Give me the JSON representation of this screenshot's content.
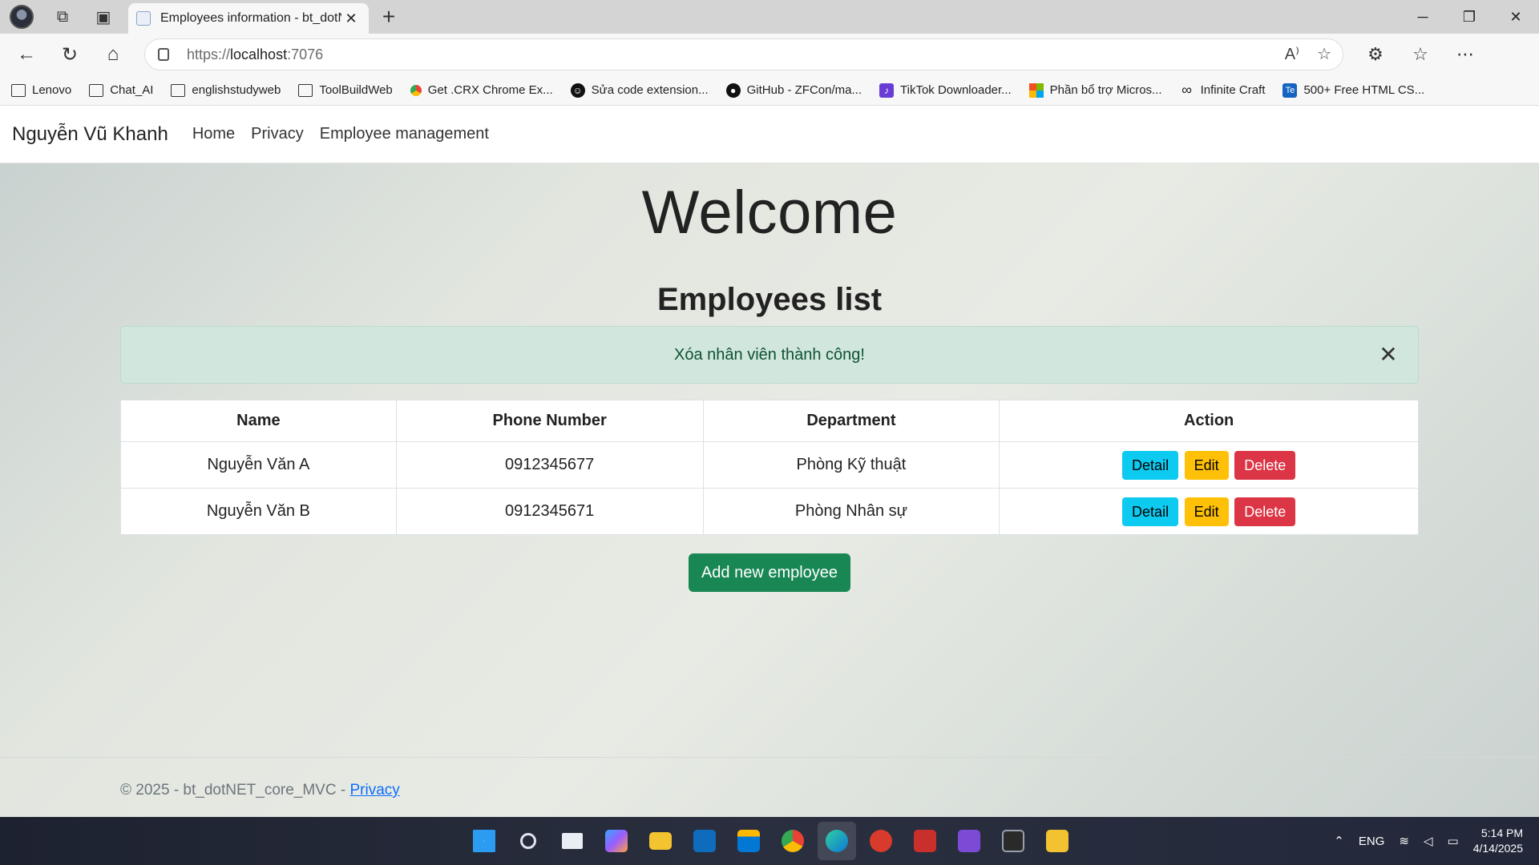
{
  "browser": {
    "tab_title": "Employees information - bt_dotNET_core_MVC",
    "url_scheme": "https://",
    "url_host": "localhost",
    "url_port": ":7076",
    "bookmarks": [
      {
        "label": "Lenovo",
        "icon": "folder-icon"
      },
      {
        "label": "Chat_AI",
        "icon": "folder-icon"
      },
      {
        "label": "englishstudyweb",
        "icon": "folder-icon"
      },
      {
        "label": "ToolBuildWeb",
        "icon": "folder-icon"
      },
      {
        "label": "Get .CRX Chrome Ex...",
        "icon": "chrome-icon"
      },
      {
        "label": "Sửa code extension...",
        "icon": "bot-icon"
      },
      {
        "label": "GitHub - ZFCon/ma...",
        "icon": "github-icon"
      },
      {
        "label": "TikTok Downloader...",
        "icon": "tiktok-icon"
      },
      {
        "label": "Phần bổ trợ Micros...",
        "icon": "microsoft-icon"
      },
      {
        "label": "Infinite Craft",
        "icon": "infinity-icon"
      },
      {
        "label": "500+ Free HTML CS...",
        "icon": "te-icon"
      }
    ]
  },
  "navbar": {
    "brand": "Nguyễn Vũ Khanh",
    "links": [
      "Home",
      "Privacy",
      "Employee management"
    ]
  },
  "main": {
    "welcome": "Welcome",
    "list_title": "Employees list",
    "alert": "Xóa nhân viên thành công!",
    "table": {
      "headers": [
        "Name",
        "Phone Number",
        "Department",
        "Action"
      ],
      "rows": [
        {
          "name": "Nguyễn Văn A",
          "phone": "0912345677",
          "department": "Phòng Kỹ thuật"
        },
        {
          "name": "Nguyễn Văn B",
          "phone": "0912345671",
          "department": "Phòng Nhân sự"
        }
      ],
      "actions": {
        "detail": "Detail",
        "edit": "Edit",
        "delete": "Delete"
      }
    },
    "add_button": "Add new employee"
  },
  "footer": {
    "text": "© 2025 - bt_dotNET_core_MVC - ",
    "link": "Privacy"
  },
  "taskbar": {
    "language": "ENG",
    "time": "5:14 PM",
    "date": "4/14/2025"
  },
  "colors": {
    "info": "#0dcaf0",
    "warning": "#ffc107",
    "danger": "#dc3545",
    "success": "#198754",
    "alert_bg": "#d1e7dd"
  }
}
